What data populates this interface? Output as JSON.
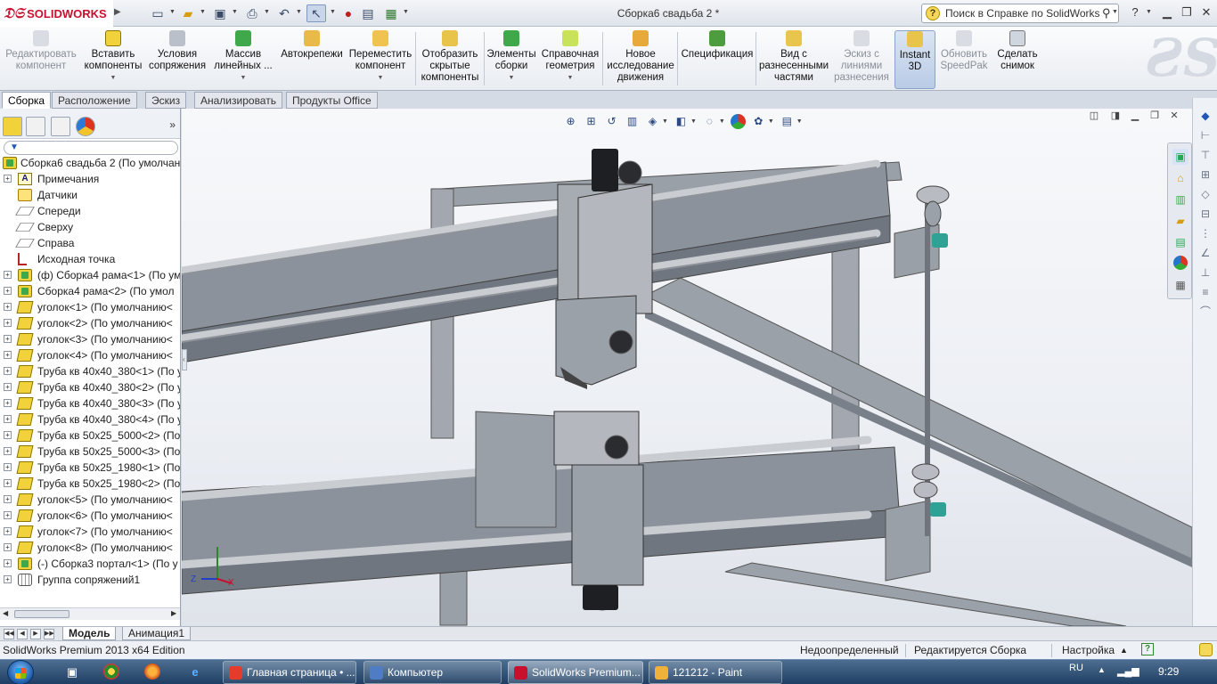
{
  "app": {
    "brand": "SOLIDWORKS",
    "document_title": "Сборка6 свадьба 2 *",
    "help_search_placeholder": "Поиск в Справке по SolidWorks",
    "help_symbol": "?"
  },
  "commands": [
    {
      "label": "Редактировать компонент",
      "disabled": true
    },
    {
      "label": "Вставить компоненты"
    },
    {
      "label": "Условия сопряжения"
    },
    {
      "label": "Массив линейных ..."
    },
    {
      "label": "Автокрепежи"
    },
    {
      "label": "Переместить компонент"
    },
    {
      "label": "Отобразить скрытые компоненты"
    },
    {
      "label": "Элементы сборки"
    },
    {
      "label": "Справочная геометрия"
    },
    {
      "label": "Новое исследование движения"
    },
    {
      "label": "Спецификация"
    },
    {
      "label": "Вид с разнесенными частями"
    },
    {
      "label": "Эскиз с линиями разнесения",
      "disabled": true
    },
    {
      "label": "Instant 3D",
      "active": true
    },
    {
      "label": "Обновить SpeedPak",
      "disabled": true
    },
    {
      "label": "Сделать снимок"
    }
  ],
  "tabs": [
    "Сборка",
    "Расположение",
    "Эскиз",
    "Анализировать",
    "Продукты Office"
  ],
  "tree": {
    "root": "Сборка6 свадьба 2  (По умолчан",
    "items": [
      {
        "label": "Примечания",
        "icon": "note",
        "expandable": true
      },
      {
        "label": "Датчики",
        "icon": "sensor"
      },
      {
        "label": "Спереди",
        "icon": "plane"
      },
      {
        "label": "Сверху",
        "icon": "plane"
      },
      {
        "label": "Справа",
        "icon": "plane"
      },
      {
        "label": "Исходная точка",
        "icon": "origin"
      },
      {
        "label": "(ф) Сборка4 рама<1> (По ум",
        "icon": "asm",
        "expandable": true
      },
      {
        "label": "Сборка4 рама<2> (По умол",
        "icon": "asm",
        "expandable": true
      },
      {
        "label": "уголок<1> (По умолчанию<",
        "icon": "part",
        "expandable": true
      },
      {
        "label": "уголок<2> (По умолчанию<",
        "icon": "part",
        "expandable": true
      },
      {
        "label": "уголок<3> (По умолчанию<",
        "icon": "part",
        "expandable": true
      },
      {
        "label": "уголок<4> (По умолчанию<",
        "icon": "part",
        "expandable": true
      },
      {
        "label": "Труба кв 40х40_380<1> (По ум",
        "icon": "part",
        "expandable": true
      },
      {
        "label": "Труба кв 40х40_380<2> (По у",
        "icon": "part",
        "expandable": true
      },
      {
        "label": "Труба кв 40х40_380<3> (По у",
        "icon": "part",
        "expandable": true
      },
      {
        "label": "Труба кв 40х40_380<4> (По у",
        "icon": "part",
        "expandable": true
      },
      {
        "label": "Труба кв 50х25_5000<2> (По у",
        "icon": "part",
        "expandable": true
      },
      {
        "label": "Труба кв 50х25_5000<3> (По у",
        "icon": "part",
        "expandable": true
      },
      {
        "label": "Труба кв 50х25_1980<1> (По у",
        "icon": "part",
        "expandable": true
      },
      {
        "label": "Труба кв 50х25_1980<2> (По у",
        "icon": "part",
        "expandable": true
      },
      {
        "label": "уголок<5> (По умолчанию<",
        "icon": "part",
        "expandable": true
      },
      {
        "label": "уголок<6> (По умолчанию<",
        "icon": "part",
        "expandable": true
      },
      {
        "label": "уголок<7> (По умолчанию<",
        "icon": "part",
        "expandable": true
      },
      {
        "label": "уголок<8> (По умолчанию<",
        "icon": "part",
        "expandable": true
      },
      {
        "label": "(-) Сборка3 портал<1> (По у",
        "icon": "asm",
        "expandable": true
      },
      {
        "label": "Группа сопряжений1",
        "icon": "mates",
        "expandable": true
      }
    ]
  },
  "bottom_tabs": [
    "Модель",
    "Анимация1"
  ],
  "status": {
    "edition": "SolidWorks Premium 2013 x64 Edition",
    "definition": "Недоопределенный",
    "editing": "Редактируется Сборка",
    "settings": "Настройка",
    "help_symbol": "?"
  },
  "triad": {
    "z": "Z",
    "x": "X",
    "y": "Y"
  },
  "taskbar": {
    "windows": [
      {
        "label": "Главная страница • ...",
        "icon_color": "#e43b2c"
      },
      {
        "label": "Компьютер",
        "icon_color": "#4f7cc2"
      },
      {
        "label": "SolidWorks Premium...",
        "icon_color": "#c8102e",
        "active": true
      },
      {
        "label": "121212 - Paint",
        "icon_color": "#f0b13a"
      }
    ],
    "lang": "RU",
    "time": "9:29"
  },
  "colors": {
    "accent": "#c8102e",
    "steel": "#7d8592",
    "rail": "#a9adb2",
    "motor": "#1d1f23"
  }
}
